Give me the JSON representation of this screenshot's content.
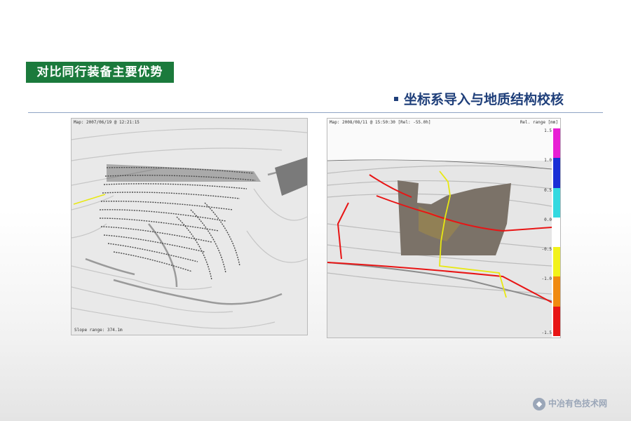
{
  "header": {
    "title": "对比同行装备主要优势",
    "subtitle": "坐标系导入与地质结构校核"
  },
  "left_panel": {
    "caption": "Map: 2007/06/19 @ 12:21:15",
    "footer": "Slope range: 374.1m"
  },
  "right_panel": {
    "caption": "Map: 2008/08/11 @ 15:50:30 [Rel: -55.0h]",
    "scale_title": "Rel. range [mm]",
    "scale": [
      {
        "label": "1.5",
        "color": "#e81fd4"
      },
      {
        "label": "1.0",
        "color": "#1a2fd6"
      },
      {
        "label": "0.5",
        "color": "#33d9e0"
      },
      {
        "label": "0.0",
        "color": "#ffffff"
      },
      {
        "label": "-0.5",
        "color": "#f2f21a"
      },
      {
        "label": "-1.0",
        "color": "#f08a10"
      },
      {
        "label": "-1.5",
        "color": "#e81515"
      }
    ]
  },
  "watermark": {
    "text": "中冶有色技术网",
    "icon": "brand-logo-icon"
  }
}
